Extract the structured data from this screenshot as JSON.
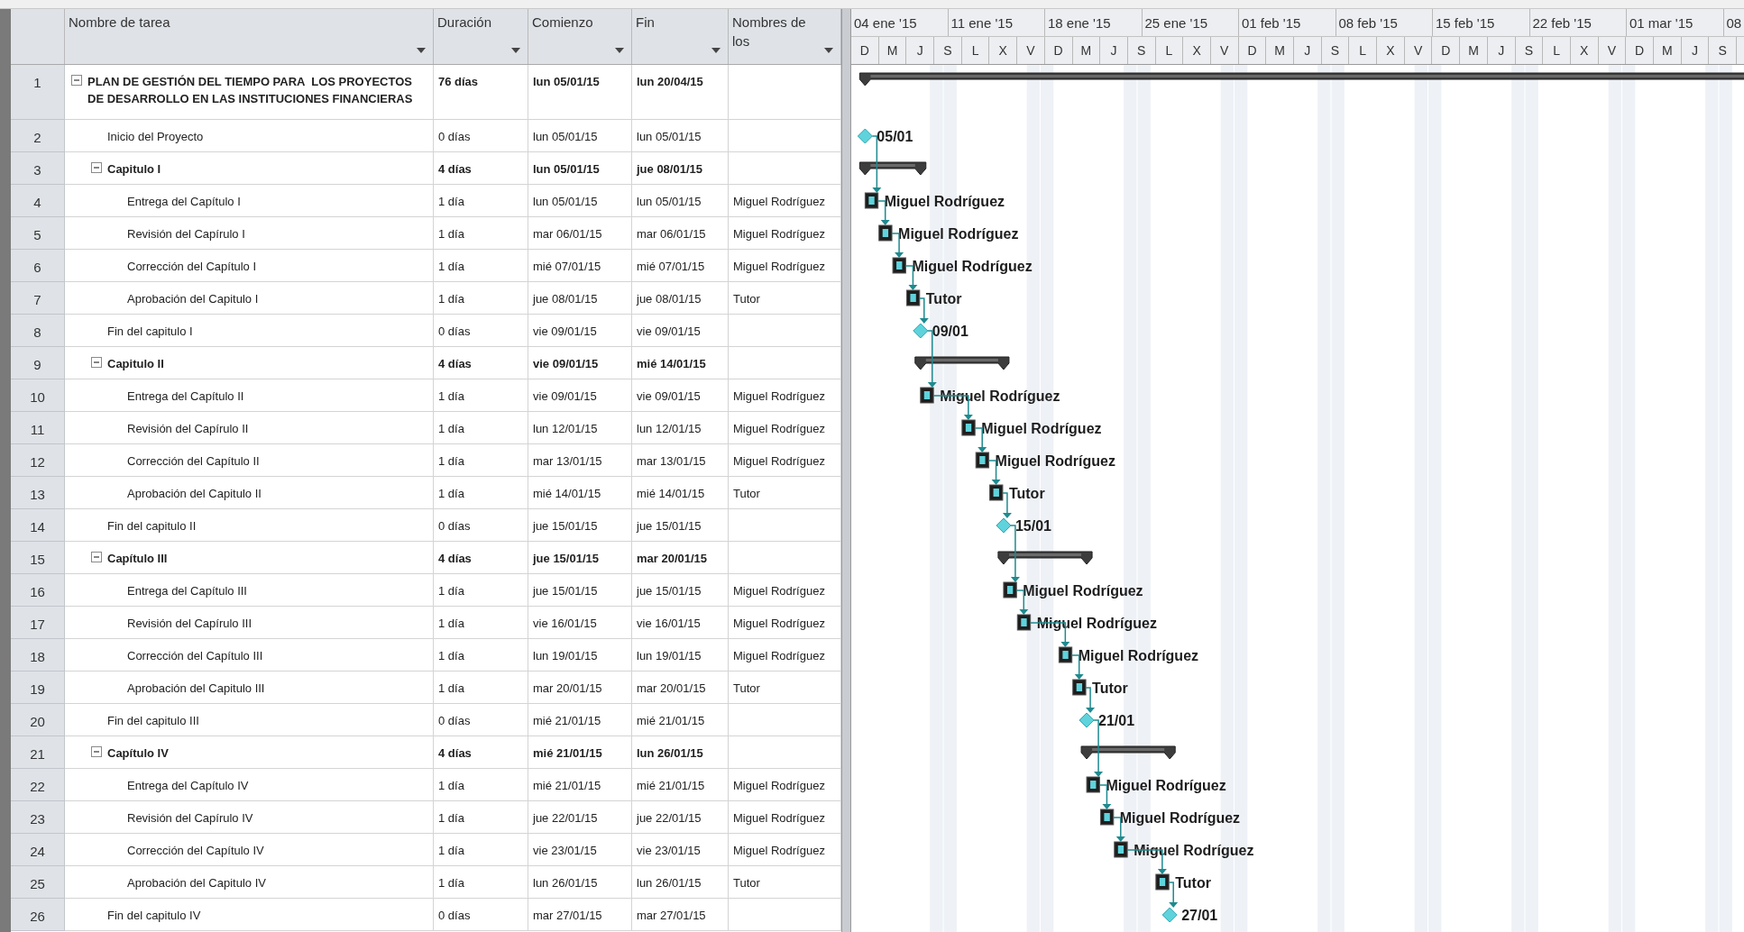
{
  "columns": [
    {
      "label": "Nombre de tarea"
    },
    {
      "label": "Duración"
    },
    {
      "label": "Comienzo"
    },
    {
      "label": "Fin"
    },
    {
      "label": "Nombres de los"
    }
  ],
  "timescale": {
    "weeks": [
      "04 ene '15",
      "11 ene '15",
      "18 ene '15",
      "25 ene '15",
      "01 feb '15",
      "08 feb '15",
      "15 feb '15",
      "22 feb '15",
      "01 mar '15",
      "08"
    ],
    "days": [
      "D",
      "M",
      "J",
      "S",
      "L",
      "X",
      "V",
      "D",
      "M",
      "J",
      "S",
      "L",
      "X",
      "V",
      "D",
      "M",
      "J",
      "S",
      "L",
      "X",
      "V",
      "D",
      "M",
      "J",
      "S",
      "L",
      "X",
      "V",
      "D",
      "M",
      "J",
      "S"
    ]
  },
  "tasks": [
    {
      "id": "1",
      "kind": "summary",
      "expanded": true,
      "name": "PLAN DE GESTIÓN DEL TIEMPO PARA  LOS PROYECTOS DE DESARROLLO EN LAS INSTITUCIONES FINANCIERAS",
      "duration": "76 días",
      "start": "lun 05/01/15",
      "finish": "lun 20/04/15",
      "children": [
        {
          "id": "2",
          "kind": "milestone",
          "name": "Inicio del Proyecto",
          "duration": "0 días",
          "start": "lun 05/01/15",
          "finish": "lun 05/01/15",
          "bar_label": "05/01"
        },
        {
          "id": "3",
          "kind": "summary",
          "expanded": true,
          "name": "Capitulo I",
          "duration": "4 días",
          "start": "lun 05/01/15",
          "finish": "jue 08/01/15",
          "children": [
            {
              "id": "4",
              "kind": "task",
              "name": "Entrega del Capítulo I",
              "duration": "1 día",
              "start": "lun 05/01/15",
              "finish": "lun 05/01/15",
              "resource": "Miguel Rodríguez",
              "bar_label": "Miguel Rodríguez"
            },
            {
              "id": "5",
              "kind": "task",
              "name": "Revisión del Capírulo I",
              "duration": "1 día",
              "start": "mar 06/01/15",
              "finish": "mar 06/01/15",
              "resource": "Miguel Rodríguez",
              "bar_label": "Miguel Rodríguez"
            },
            {
              "id": "6",
              "kind": "task",
              "name": "Corrección del Capítulo I",
              "duration": "1 día",
              "start": "mié 07/01/15",
              "finish": "mié 07/01/15",
              "resource": "Miguel Rodríguez",
              "bar_label": "Miguel Rodríguez"
            },
            {
              "id": "7",
              "kind": "task",
              "name": "Aprobación del Capitulo I",
              "duration": "1 día",
              "start": "jue 08/01/15",
              "finish": "jue 08/01/15",
              "resource": "Tutor",
              "bar_label": "Tutor"
            }
          ]
        },
        {
          "id": "8",
          "kind": "milestone",
          "name": "Fin del capitulo I",
          "duration": "0 días",
          "start": "vie 09/01/15",
          "finish": "vie 09/01/15",
          "bar_label": "09/01"
        },
        {
          "id": "9",
          "kind": "summary",
          "expanded": true,
          "name": "Capitulo II",
          "duration": "4 días",
          "start": "vie 09/01/15",
          "finish": "mié 14/01/15",
          "children": [
            {
              "id": "10",
              "kind": "task",
              "name": "Entrega del Capítulo II",
              "duration": "1 día",
              "start": "vie 09/01/15",
              "finish": "vie 09/01/15",
              "resource": "Miguel Rodríguez",
              "bar_label": "Miguel Rodríguez"
            },
            {
              "id": "11",
              "kind": "task",
              "name": "Revisión del Capírulo II",
              "duration": "1 día",
              "start": "lun 12/01/15",
              "finish": "lun 12/01/15",
              "resource": "Miguel Rodríguez",
              "bar_label": "Miguel Rodríguez"
            },
            {
              "id": "12",
              "kind": "task",
              "name": "Corrección del Capítulo II",
              "duration": "1 día",
              "start": "mar 13/01/15",
              "finish": "mar 13/01/15",
              "resource": "Miguel Rodríguez",
              "bar_label": "Miguel Rodríguez"
            },
            {
              "id": "13",
              "kind": "task",
              "name": "Aprobación del Capitulo II",
              "duration": "1 día",
              "start": "mié 14/01/15",
              "finish": "mié 14/01/15",
              "resource": "Tutor",
              "bar_label": "Tutor"
            }
          ]
        },
        {
          "id": "14",
          "kind": "milestone",
          "name": "Fin del capitulo II",
          "duration": "0 días",
          "start": "jue 15/01/15",
          "finish": "jue 15/01/15",
          "bar_label": "15/01"
        },
        {
          "id": "15",
          "kind": "summary",
          "expanded": true,
          "name": "Capítulo III",
          "duration": "4 días",
          "start": "jue 15/01/15",
          "finish": "mar 20/01/15",
          "children": [
            {
              "id": "16",
              "kind": "task",
              "name": "Entrega del Capítulo III",
              "duration": "1 día",
              "start": "jue 15/01/15",
              "finish": "jue 15/01/15",
              "resource": "Miguel Rodríguez",
              "bar_label": "Miguel Rodríguez"
            },
            {
              "id": "17",
              "kind": "task",
              "name": "Revisión del Capírulo III",
              "duration": "1 día",
              "start": "vie 16/01/15",
              "finish": "vie 16/01/15",
              "resource": "Miguel Rodríguez",
              "bar_label": "Miguel Rodríguez"
            },
            {
              "id": "18",
              "kind": "task",
              "name": "Corrección del Capítulo III",
              "duration": "1 día",
              "start": "lun 19/01/15",
              "finish": "lun 19/01/15",
              "resource": "Miguel Rodríguez",
              "bar_label": "Miguel Rodríguez"
            },
            {
              "id": "19",
              "kind": "task",
              "name": "Aprobación del Capitulo III",
              "duration": "1 día",
              "start": "mar 20/01/15",
              "finish": "mar 20/01/15",
              "resource": "Tutor",
              "bar_label": "Tutor"
            }
          ]
        },
        {
          "id": "20",
          "kind": "milestone",
          "name": "Fin del capitulo III",
          "duration": "0 días",
          "start": "mié 21/01/15",
          "finish": "mié 21/01/15",
          "bar_label": "21/01"
        },
        {
          "id": "21",
          "kind": "summary",
          "expanded": true,
          "name": "Capítulo IV",
          "duration": "4 días",
          "start": "mié 21/01/15",
          "finish": "lun 26/01/15",
          "children": [
            {
              "id": "22",
              "kind": "task",
              "name": "Entrega del Capítulo IV",
              "duration": "1 día",
              "start": "mié 21/01/15",
              "finish": "mié 21/01/15",
              "resource": "Miguel Rodríguez",
              "bar_label": "Miguel Rodríguez"
            },
            {
              "id": "23",
              "kind": "task",
              "name": "Revisión del Capírulo IV",
              "duration": "1 día",
              "start": "jue 22/01/15",
              "finish": "jue 22/01/15",
              "resource": "Miguel Rodríguez",
              "bar_label": "Miguel Rodríguez"
            },
            {
              "id": "24",
              "kind": "task",
              "name": "Corrección del Capítulo IV",
              "duration": "1 día",
              "start": "vie 23/01/15",
              "finish": "vie 23/01/15",
              "resource": "Miguel Rodríguez",
              "bar_label": "Miguel Rodríguez"
            },
            {
              "id": "25",
              "kind": "task",
              "name": "Aprobación del Capitulo IV",
              "duration": "1 día",
              "start": "lun 26/01/15",
              "finish": "lun 26/01/15",
              "resource": "Tutor",
              "bar_label": "Tutor"
            }
          ]
        },
        {
          "id": "26",
          "kind": "milestone",
          "name": "Fin del capitulo IV",
          "duration": "0 días",
          "start": "mar 27/01/15",
          "finish": "mar 27/01/15",
          "bar_label": "27/01"
        }
      ]
    }
  ]
}
